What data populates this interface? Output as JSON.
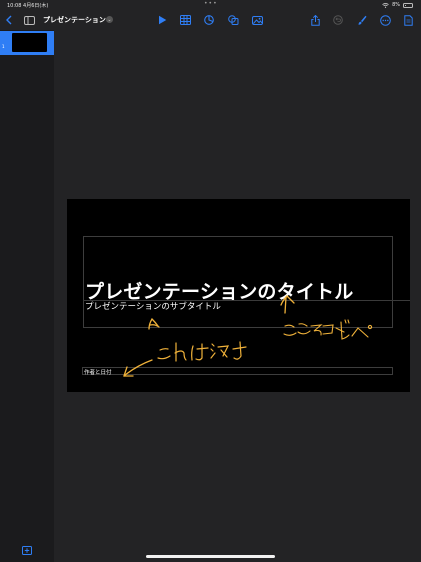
{
  "status_bar": {
    "time": "10:08",
    "date": "4月6日(木)",
    "dots": "•••",
    "battery": "8%"
  },
  "document": {
    "title": "プレゼンテーション"
  },
  "toolbar": {
    "icons": [
      "back-icon",
      "sidebar-icon",
      "play-icon",
      "table-icon",
      "chart-icon",
      "shape-icon",
      "media-icon",
      "share-icon",
      "undo-icon",
      "brush-icon",
      "more-icon",
      "document-icon"
    ]
  },
  "slide_navigator": {
    "slides": [
      {
        "number": "1",
        "selected": true
      }
    ]
  },
  "slide": {
    "title": "プレゼンテーションのタイトル",
    "subtitle": "プレゼンテーションのサブタイトル",
    "author_date": "作者と日付"
  },
  "annotations": {
    "erase_note": "これは消す",
    "copy_note": "ここをコピペ"
  },
  "colors": {
    "accent": "#2f7ef5",
    "ink": "#f0b23a",
    "background": "#232325",
    "slide": "#000000"
  }
}
